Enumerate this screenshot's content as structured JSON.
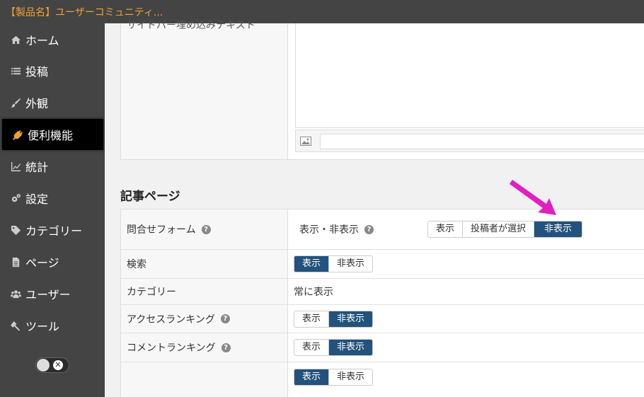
{
  "app": {
    "title": "【製品名】ユーザーコミュニティ..."
  },
  "sidebar": {
    "items": [
      {
        "label": "ホーム",
        "icon": "home-icon"
      },
      {
        "label": "投稿",
        "icon": "list-icon"
      },
      {
        "label": "外観",
        "icon": "brush-icon"
      },
      {
        "label": "便利機能",
        "icon": "plug-icon",
        "active": true
      },
      {
        "label": "統計",
        "icon": "chart-icon"
      },
      {
        "label": "設定",
        "icon": "gears-icon"
      },
      {
        "label": "カテゴリー",
        "icon": "tag-icon"
      },
      {
        "label": "ページ",
        "icon": "page-icon"
      },
      {
        "label": "ユーザー",
        "icon": "users-icon"
      },
      {
        "label": "ツール",
        "icon": "wrench-icon"
      }
    ],
    "toggle_state": "off"
  },
  "sidebar_widget": {
    "cut_label": "サイドバー埋め込みテキスト"
  },
  "article_section": {
    "heading": "記事ページ",
    "rows": {
      "contact": {
        "label": "問合せフォーム",
        "sub_label": "表示・非表示",
        "options": [
          "表示",
          "投稿者が選択",
          "非表示"
        ],
        "selected": "非表示"
      },
      "search": {
        "label": "検索",
        "options": [
          "表示",
          "非表示"
        ],
        "selected": "表示"
      },
      "category": {
        "label": "カテゴリー",
        "value": "常に表示"
      },
      "access_ranking": {
        "label": "アクセスランキング",
        "options": [
          "表示",
          "非表示"
        ],
        "selected": "非表示"
      },
      "comment_ranking": {
        "label": "コメントランキング",
        "options": [
          "表示",
          "非表示"
        ],
        "selected": "非表示"
      },
      "unlabeled": {
        "label": "",
        "options": [
          "表示",
          "非表示"
        ],
        "selected": "表示"
      }
    }
  },
  "colors": {
    "sidebar_bg": "#444444",
    "accent_orange": "#f0a030",
    "selected_button": "#23527c",
    "annotation_arrow": "#e020c0"
  }
}
